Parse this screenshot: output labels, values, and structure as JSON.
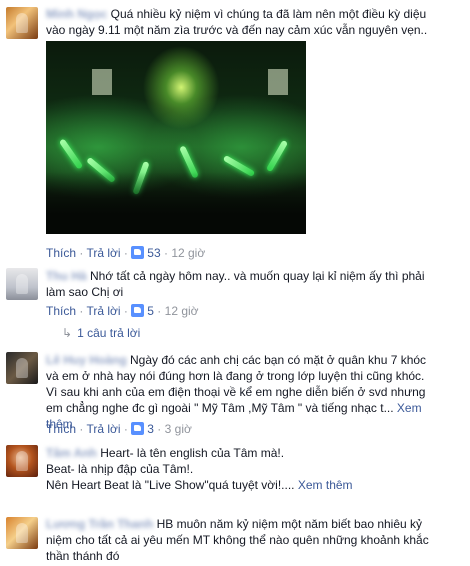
{
  "action_labels": {
    "like": "Thích",
    "reply": "Trả lời",
    "separator": "·",
    "see_more": "Xem thêm"
  },
  "comments": [
    {
      "author": "Minh Ngọc",
      "text": "Quá nhiều kỷ niệm vì chúng ta đã làm nên một điều kỳ diệu vào ngày 9.11 một năm zìa trước và đến nay cảm xúc vẫn nguyên vẹn..",
      "likes": "53",
      "time": "12 giờ",
      "has_photo": true
    },
    {
      "author": "Thu Hà",
      "text": "Nhớ tất cả ngày hôm nay.. và muốn quay lại kỉ niệm ấy thì phải làm sao Chị ơi",
      "likes": "5",
      "time": "12 giờ",
      "reply_count_label": "1 câu trả lời"
    },
    {
      "author": "Lê Huy Hoàng",
      "text": "Ngày đó các anh chị các bạn có mặt ở quân khu 7 khóc và em ở nhà hay nói đúng hơn là đang ở trong lớp luyện thi cũng khóc. Vì sau khi anh của em điện thoại về kể em nghe diễn biến ở svd nhưng em chẳng nghe đc gì ngoài \" Mỹ Tâm ,Mỹ Tâm \" và tiếng nhạc t...",
      "likes": "3",
      "time": "3 giờ"
    },
    {
      "author": "Tâm Anh",
      "text_lines": [
        "Heart- là tên english của Tâm mà!.",
        "Beat- là nhịp đập của Tâm!.",
        "Nên Heart Beat là \"Live Show\"quá tuyệt vời!...."
      ]
    },
    {
      "author": "Lương Trần Thanh",
      "text": "HB muôn năm kỷ niệm một năm biết bao nhiêu kỷ niệm cho tất cả ai yêu mến MT không thể nào quên những khoảnh khắc thần thánh đó"
    }
  ]
}
